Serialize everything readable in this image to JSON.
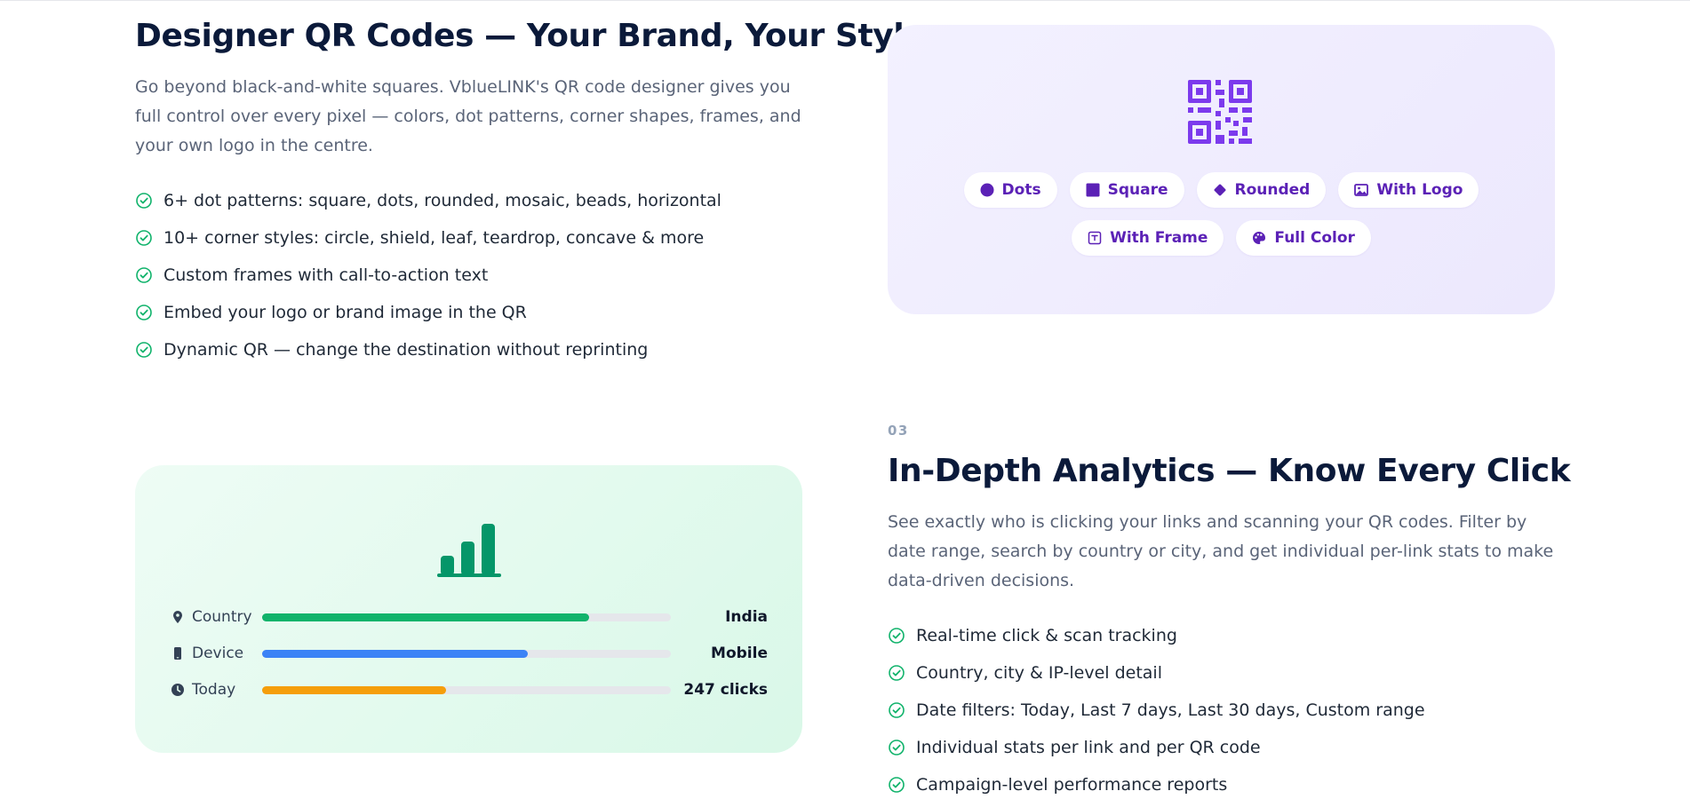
{
  "qr_section": {
    "title": "Designer QR Codes — Your Brand, Your Style",
    "description": "Go beyond black-and-white squares. VblueLINK's QR code designer gives you full control over every pixel — colors, dot patterns, corner shapes, frames, and your own logo in the centre.",
    "features": [
      "6+ dot patterns: square, dots, rounded, mosaic, beads, horizontal",
      "10+ corner styles: circle, shield, leaf, teardrop, concave & more",
      "Custom frames with call-to-action text",
      "Embed your logo or brand image in the QR",
      "Dynamic QR — change the destination without reprinting"
    ],
    "card": {
      "icon": "qr-code-icon",
      "pills": [
        {
          "label": "Dots",
          "icon": "circle-icon"
        },
        {
          "label": "Square",
          "icon": "square-icon"
        },
        {
          "label": "Rounded",
          "icon": "diamond-icon"
        },
        {
          "label": "With Logo",
          "icon": "image-icon"
        },
        {
          "label": "With Frame",
          "icon": "frame-icon"
        },
        {
          "label": "Full Color",
          "icon": "palette-icon"
        }
      ]
    }
  },
  "analytics_section": {
    "eyebrow": "03",
    "title": "In-Depth Analytics — Know Every Click",
    "description": "See exactly who is clicking your links and scanning your QR codes. Filter by date range, search by country or city, and get individual per-link stats to make data-driven decisions.",
    "features": [
      "Real-time click & scan tracking",
      "Country, city & IP-level detail",
      "Date filters: Today, Last 7 days, Last 30 days, Custom range",
      "Individual stats per link and per QR code",
      "Campaign-level performance reports"
    ],
    "card": {
      "icon": "bar-chart-icon",
      "rows": [
        {
          "label": "Country",
          "icon": "map-pin-icon",
          "value": "India",
          "fraction": 0.8,
          "color": "#10b36b"
        },
        {
          "label": "Device",
          "icon": "phone-icon",
          "value": "Mobile",
          "fraction": 0.65,
          "color": "#3b82f6"
        },
        {
          "label": "Today",
          "icon": "clock-icon",
          "value": "247 clicks",
          "fraction": 0.45,
          "color": "#f59e0b"
        }
      ]
    }
  },
  "colors": {
    "check": "#10b36b",
    "purple_accent": "#7c3aed",
    "green_accent": "#059669",
    "heading": "#0b1a3a"
  }
}
